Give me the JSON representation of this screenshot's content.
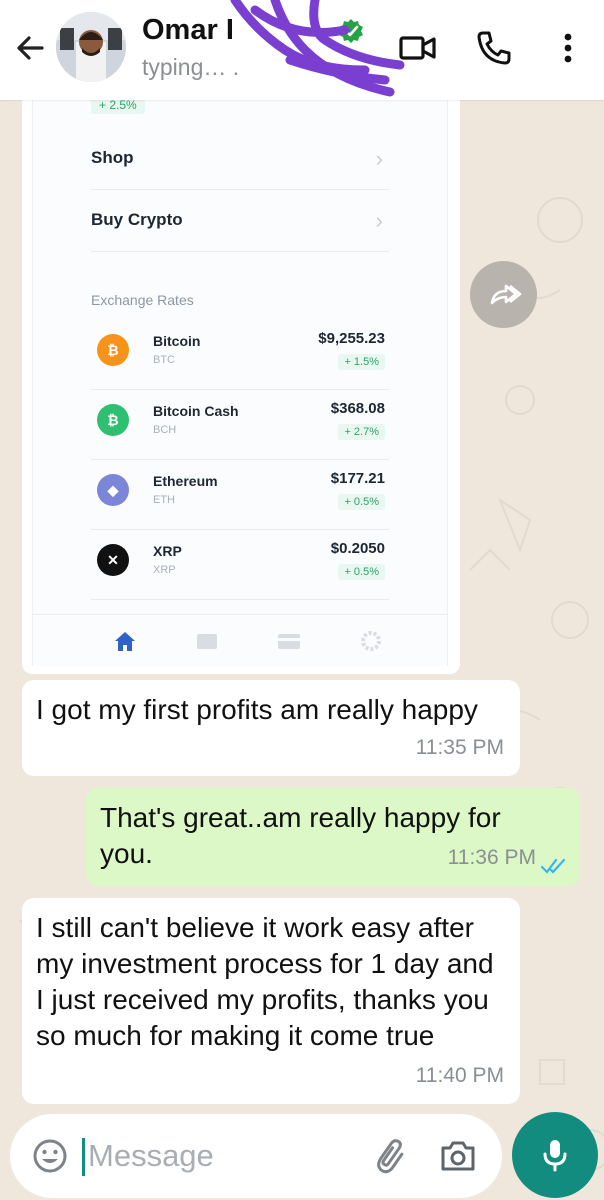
{
  "header": {
    "back_icon": "arrow-left-icon",
    "contact_name": "Omar I",
    "status": "typing… .",
    "verified_icon": "verified-badge-icon",
    "video_icon": "video-camera-icon",
    "call_icon": "phone-icon",
    "menu_icon": "more-vert-icon"
  },
  "screenshot": {
    "top_change": "+ 2.5%",
    "menu": [
      {
        "label": "Shop",
        "chevron": "›"
      },
      {
        "label": "Buy Crypto",
        "chevron": "›"
      }
    ],
    "section_title": "Exchange Rates",
    "coins": [
      {
        "name": "Bitcoin",
        "symbol": "BTC",
        "price": "$9,255.23",
        "change": "+ 1.5%",
        "logo_letter": "₿",
        "color": "#f7931a"
      },
      {
        "name": "Bitcoin Cash",
        "symbol": "BCH",
        "price": "$368.08",
        "change": "+ 2.7%",
        "logo_letter": "₿",
        "color": "#2fbf71"
      },
      {
        "name": "Ethereum",
        "symbol": "ETH",
        "price": "$177.21",
        "change": "+ 0.5%",
        "logo_letter": "◆",
        "color": "#7b86d9"
      },
      {
        "name": "XRP",
        "symbol": "XRP",
        "price": "$0.2050",
        "change": "+ 0.5%",
        "logo_letter": "✕",
        "color": "#111111"
      }
    ],
    "tab_icons": [
      "home-icon",
      "wallet-icon",
      "card-icon",
      "settings-icon"
    ],
    "accent_color": "#2f62c8"
  },
  "forward_icon": "forward-icon",
  "messages": [
    {
      "direction": "in",
      "text": "I got my first profits am really happy",
      "time": "11:35 PM"
    },
    {
      "direction": "out",
      "text": "That's great..am really happy for you.",
      "time": "11:36 PM",
      "read_icon": "double-check-icon"
    },
    {
      "direction": "in",
      "text": "I still can't believe it work easy after my investment process for 1 day and I just received my profits, thanks you so much for making it come true",
      "time": "11:40 PM"
    }
  ],
  "composer": {
    "placeholder": "Message",
    "emoji_icon": "emoji-icon",
    "attach_icon": "paperclip-icon",
    "camera_icon": "camera-icon",
    "mic_icon": "microphone-icon"
  },
  "colors": {
    "chat_bg": "#efe7dc",
    "outgoing_bubble": "#dcf8c6",
    "whatsapp_green": "#128c7e",
    "read_tick": "#34b7f1"
  }
}
